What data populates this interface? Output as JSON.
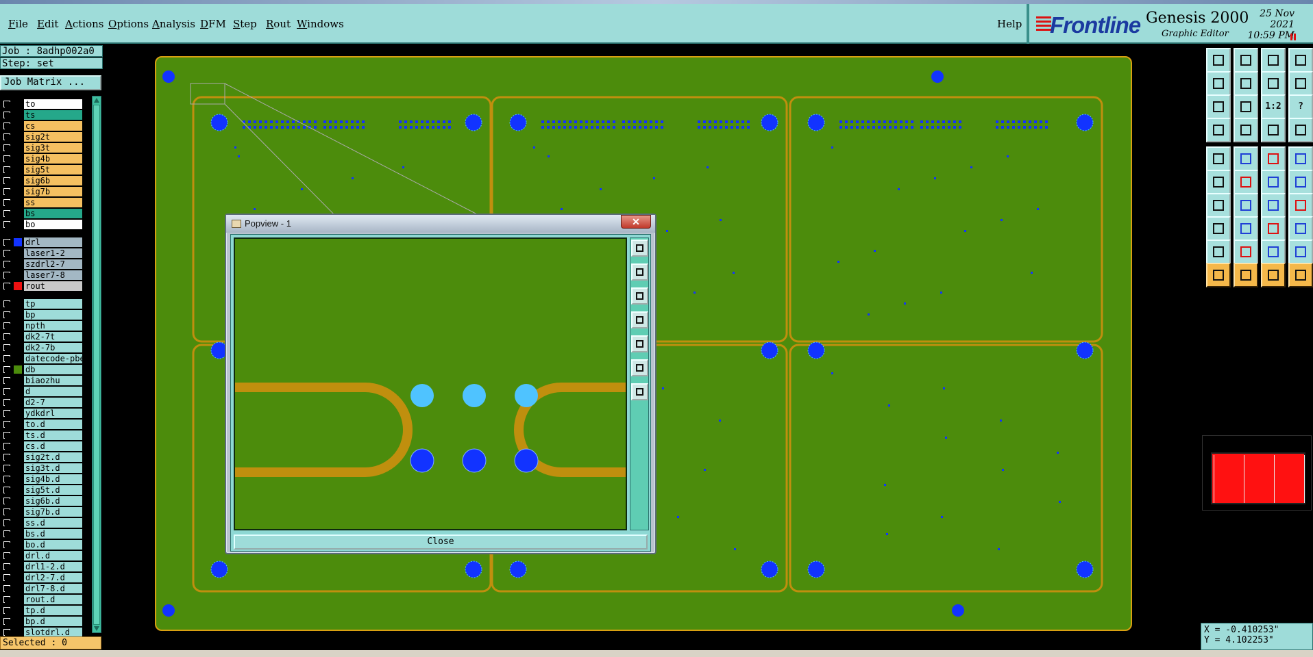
{
  "menu": {
    "items": [
      "File",
      "Edit",
      "Actions",
      "Options",
      "Analysis",
      "DFM",
      "Step",
      "Rout",
      "Windows"
    ],
    "help": "Help"
  },
  "brand": {
    "name": "Frontline",
    "product": "Genesis 2000",
    "subtitle": "Graphic Editor",
    "date": "25 Nov 2021",
    "time": "10:59 PM"
  },
  "job": {
    "label": "Job : 8adhp002a0",
    "step": "Step: set",
    "matrix_button": "Job Matrix ..."
  },
  "layers": {
    "group1": [
      {
        "name": "to",
        "color": "#ffffff",
        "swatch": ""
      },
      {
        "name": "ts",
        "color": "#25a88a",
        "swatch": ""
      },
      {
        "name": "cs",
        "color": "#f5c061",
        "swatch": ""
      },
      {
        "name": "sig2t",
        "color": "#f5c061",
        "swatch": ""
      },
      {
        "name": "sig3t",
        "color": "#f5c061",
        "swatch": ""
      },
      {
        "name": "sig4b",
        "color": "#f5c061",
        "swatch": ""
      },
      {
        "name": "sig5t",
        "color": "#f5c061",
        "swatch": ""
      },
      {
        "name": "sig6b",
        "color": "#f5c061",
        "swatch": ""
      },
      {
        "name": "sig7b",
        "color": "#f5c061",
        "swatch": ""
      },
      {
        "name": "ss",
        "color": "#f5c061",
        "swatch": ""
      },
      {
        "name": "bs",
        "color": "#25a88a",
        "swatch": ""
      },
      {
        "name": "bo",
        "color": "#ffffff",
        "swatch": ""
      }
    ],
    "group2": [
      {
        "name": "drl",
        "color": "#a3b8c4",
        "swatch": "#1233ff"
      },
      {
        "name": "laser1-2",
        "color": "#a3b8c4",
        "swatch": ""
      },
      {
        "name": "szdrl2-7",
        "color": "#a3b8c4",
        "swatch": ""
      },
      {
        "name": "laser7-8",
        "color": "#a3b8c4",
        "swatch": ""
      },
      {
        "name": "rout",
        "color": "#c9c9c9",
        "swatch": "#ee1111"
      }
    ],
    "group3": [
      {
        "name": "tp",
        "color": "#9edcd9",
        "swatch": ""
      },
      {
        "name": "bp",
        "color": "#9edcd9",
        "swatch": ""
      },
      {
        "name": "npth",
        "color": "#9edcd9",
        "swatch": ""
      },
      {
        "name": "dk2-7t",
        "color": "#9edcd9",
        "swatch": ""
      },
      {
        "name": "dk2-7b",
        "color": "#9edcd9",
        "swatch": ""
      },
      {
        "name": "datecode-pbe",
        "color": "#9edcd9",
        "swatch": ""
      },
      {
        "name": "db",
        "color": "#9edcd9",
        "swatch": "#4c8c0c"
      },
      {
        "name": "biaozhu",
        "color": "#9edcd9",
        "swatch": ""
      },
      {
        "name": "d",
        "color": "#9edcd9",
        "swatch": ""
      },
      {
        "name": "d2-7",
        "color": "#9edcd9",
        "swatch": ""
      },
      {
        "name": "ydkdrl",
        "color": "#9edcd9",
        "swatch": ""
      },
      {
        "name": "to.d",
        "color": "#9edcd9",
        "swatch": ""
      },
      {
        "name": "ts.d",
        "color": "#9edcd9",
        "swatch": ""
      },
      {
        "name": "cs.d",
        "color": "#9edcd9",
        "swatch": ""
      },
      {
        "name": "sig2t.d",
        "color": "#9edcd9",
        "swatch": ""
      },
      {
        "name": "sig3t.d",
        "color": "#9edcd9",
        "swatch": ""
      },
      {
        "name": "sig4b.d",
        "color": "#9edcd9",
        "swatch": ""
      },
      {
        "name": "sig5t.d",
        "color": "#9edcd9",
        "swatch": ""
      },
      {
        "name": "sig6b.d",
        "color": "#9edcd9",
        "swatch": ""
      },
      {
        "name": "sig7b.d",
        "color": "#9edcd9",
        "swatch": ""
      },
      {
        "name": "ss.d",
        "color": "#9edcd9",
        "swatch": ""
      },
      {
        "name": "bs.d",
        "color": "#9edcd9",
        "swatch": ""
      },
      {
        "name": "bo.d",
        "color": "#9edcd9",
        "swatch": ""
      },
      {
        "name": "drl.d",
        "color": "#9edcd9",
        "swatch": ""
      },
      {
        "name": "drl1-2.d",
        "color": "#9edcd9",
        "swatch": ""
      },
      {
        "name": "drl2-7.d",
        "color": "#9edcd9",
        "swatch": ""
      },
      {
        "name": "drl7-8.d",
        "color": "#9edcd9",
        "swatch": ""
      },
      {
        "name": "rout.d",
        "color": "#9edcd9",
        "swatch": ""
      },
      {
        "name": "tp.d",
        "color": "#9edcd9",
        "swatch": ""
      },
      {
        "name": "bp.d",
        "color": "#9edcd9",
        "swatch": ""
      },
      {
        "name": "slotdrl.d",
        "color": "#9edcd9",
        "swatch": ""
      }
    ]
  },
  "status": {
    "selected": "Selected : 0"
  },
  "popview": {
    "title": "Popview - 1",
    "close_glyph": "✕",
    "close_button": "Close"
  },
  "coords": {
    "x": "X = -0.410253\"",
    "y": "Y = 4.102253\""
  },
  "tools": {
    "ratio_label": "1:2",
    "help_label": "?"
  },
  "colors": {
    "panel": "#9edcd9",
    "board": "#4c8c0c",
    "outline": "#d9a011",
    "pad": "#1233ff",
    "pad_light": "#4fc3ff",
    "selected_bar": "#f5c56a"
  }
}
